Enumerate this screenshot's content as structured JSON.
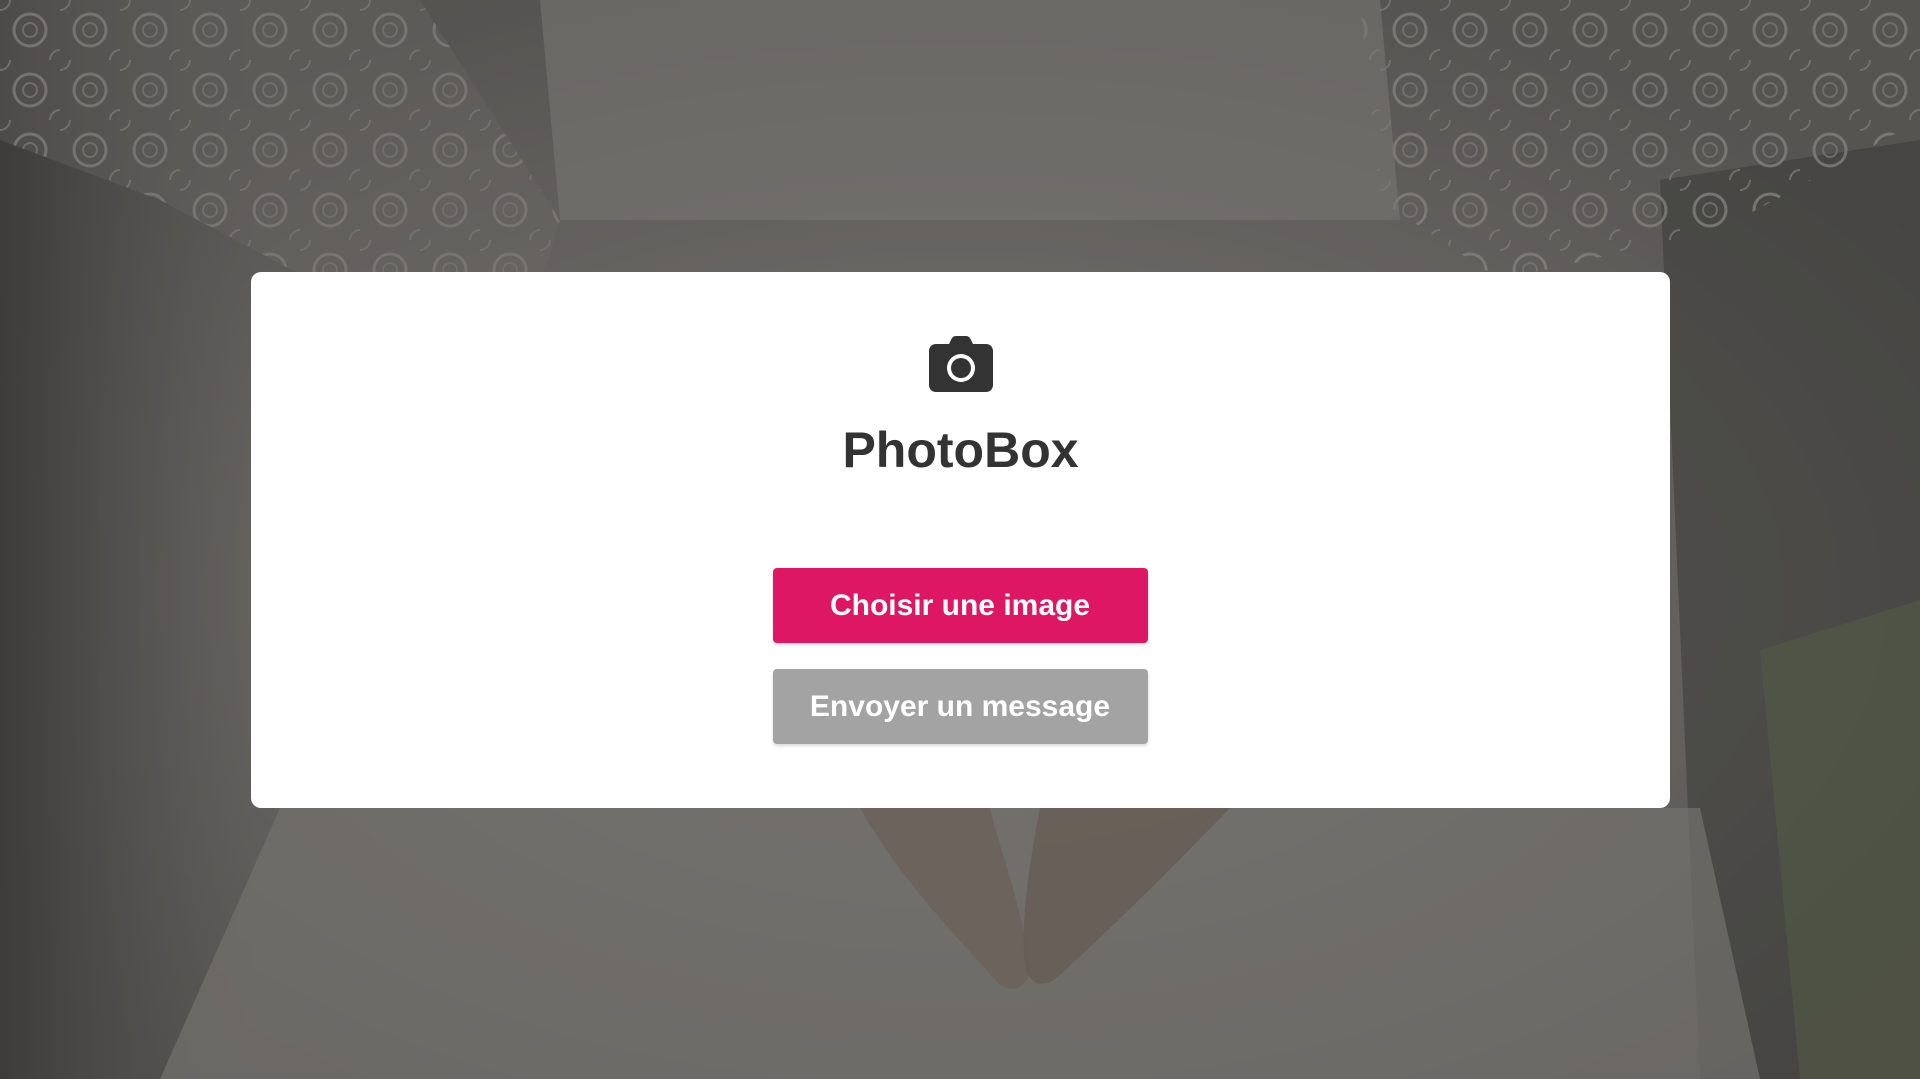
{
  "app": {
    "title": "PhotoBox",
    "icon": "camera-icon"
  },
  "actions": {
    "choose_image_label": "Choisir une image",
    "send_message_label": "Envoyer un message"
  },
  "colors": {
    "primary": "#de1764",
    "secondary": "#a3a3a3",
    "title_text": "#333333",
    "card_background": "#ffffff",
    "overlay": "#5a5856"
  }
}
